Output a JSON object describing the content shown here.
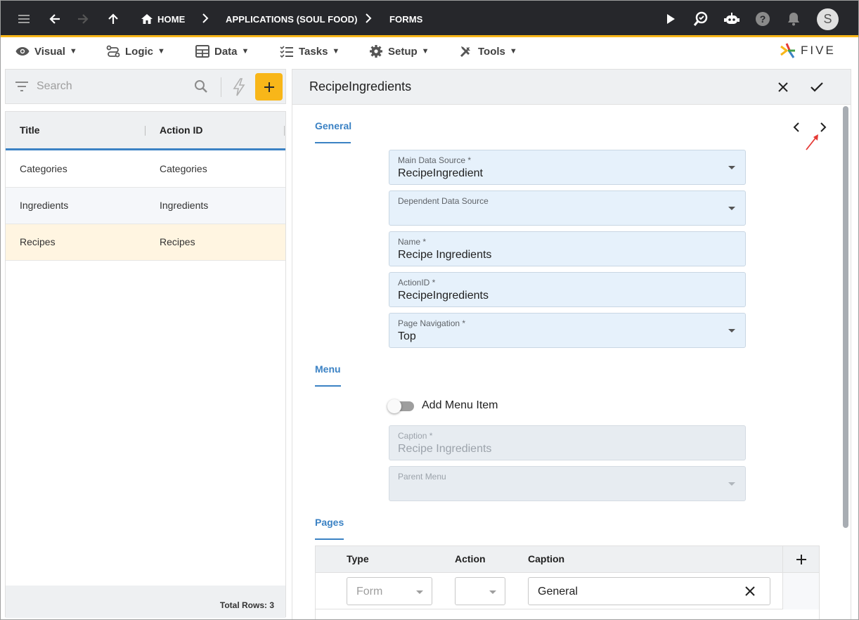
{
  "topbar": {
    "breadcrumbs": [
      "HOME",
      "APPLICATIONS (SOUL FOOD)",
      "FORMS"
    ],
    "avatar_letter": "S",
    "icons": [
      "hamburger-menu-icon",
      "back-arrow-icon",
      "forward-arrow-icon",
      "up-arrow-icon",
      "home-icon",
      "run-icon",
      "search-wrench-icon",
      "robot-icon",
      "help-icon",
      "bell-icon"
    ]
  },
  "menubar": {
    "items": [
      {
        "label": "Visual",
        "icon": "eye-icon"
      },
      {
        "label": "Logic",
        "icon": "logic-flow-icon"
      },
      {
        "label": "Data",
        "icon": "table-icon"
      },
      {
        "label": "Tasks",
        "icon": "checklist-icon"
      },
      {
        "label": "Setup",
        "icon": "gear-icon"
      },
      {
        "label": "Tools",
        "icon": "tools-icon"
      }
    ],
    "caret": "▼",
    "logo_text": "FIVE"
  },
  "left": {
    "search_placeholder": "Search",
    "columns": [
      "Title",
      "Action ID"
    ],
    "rows": [
      {
        "title": "Categories",
        "action_id": "Categories"
      },
      {
        "title": "Ingredients",
        "action_id": "Ingredients"
      },
      {
        "title": "Recipes",
        "action_id": "Recipes"
      }
    ],
    "total_rows": "Total Rows: 3"
  },
  "form": {
    "title": "RecipeIngredients",
    "general": {
      "section_title": "General",
      "main_data_source_label": "Main Data Source *",
      "main_data_source_value": "RecipeIngredient",
      "dependent_data_source_label": "Dependent Data Source",
      "dependent_data_source_value": "",
      "name_label": "Name *",
      "name_value": "Recipe Ingredients",
      "action_id_label": "ActionID *",
      "action_id_value": "RecipeIngredients",
      "page_navigation_label": "Page Navigation *",
      "page_navigation_value": "Top"
    },
    "menu": {
      "section_title": "Menu",
      "add_menu_item_label": "Add Menu Item",
      "add_menu_item_on": false,
      "caption_label": "Caption *",
      "caption_value": "Recipe Ingredients",
      "parent_menu_label": "Parent Menu",
      "parent_menu_value": ""
    },
    "pages": {
      "section_title": "Pages",
      "columns": [
        "Type",
        "Action",
        "Caption"
      ],
      "row": {
        "type_placeholder": "Form",
        "action_value": "",
        "caption_value": "General"
      }
    }
  },
  "colors": {
    "accent": "#3b82c4",
    "brand_yellow": "#f8b619",
    "topbar_bg": "#26272b",
    "annotation_arrow": "#e53935"
  }
}
